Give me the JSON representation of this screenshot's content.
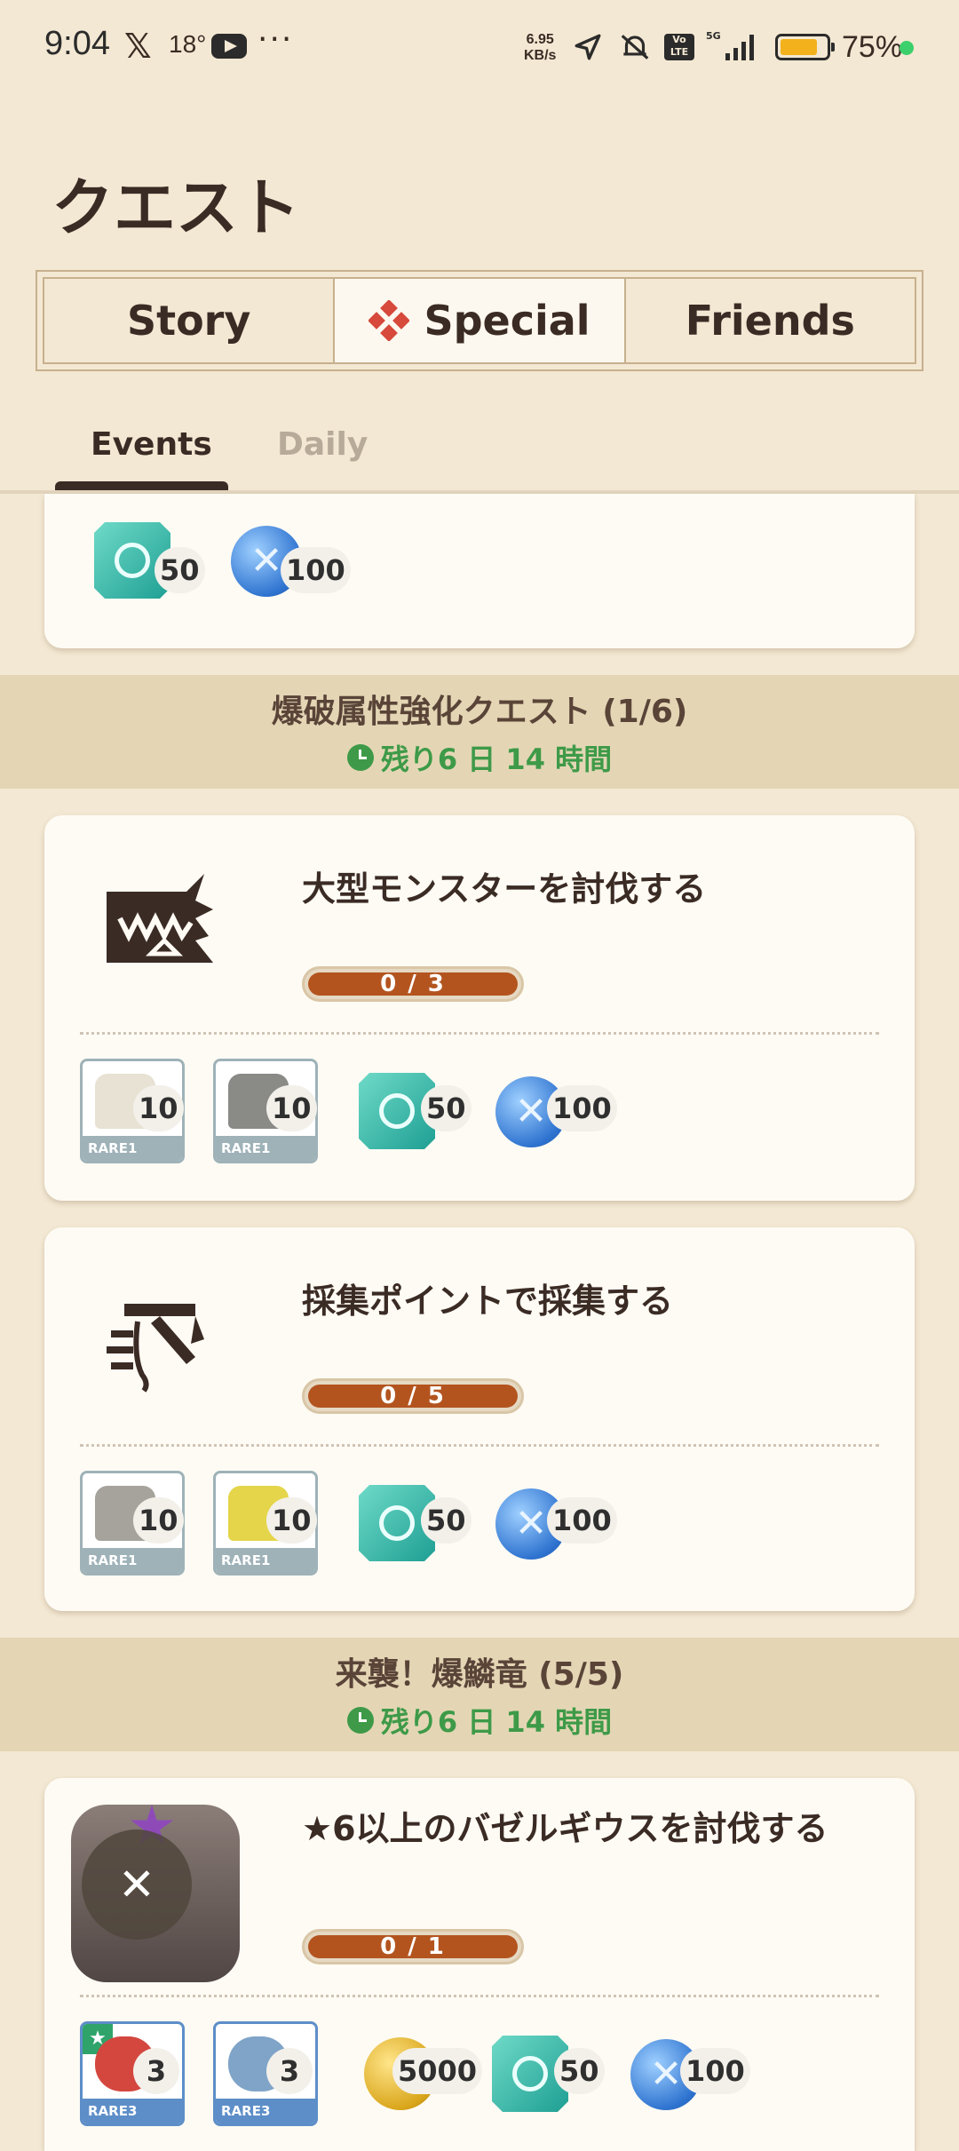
{
  "status": {
    "time": "9:04",
    "temperature": "18°",
    "speed_value": "6.95",
    "speed_unit": "KB/s",
    "network": "5G",
    "volte": "Vo LTE",
    "battery": "75%",
    "battery_level": 0.75
  },
  "page_title": "クエスト",
  "main_tabs": [
    {
      "label": "Story",
      "active": false
    },
    {
      "label": "Special",
      "active": true
    },
    {
      "label": "Friends",
      "active": false
    }
  ],
  "sub_tabs": [
    {
      "label": "Events",
      "active": true
    },
    {
      "label": "Daily",
      "active": false
    }
  ],
  "top_card": {
    "rewards": [
      {
        "icon": "gem-icon",
        "count": "50"
      },
      {
        "icon": "orb-icon",
        "count": "100"
      }
    ]
  },
  "sections": [
    {
      "title": "爆破属性強化クエスト (1/6)",
      "remaining": "残り6 日 14 時間",
      "quests": [
        {
          "title": "大型モンスターを討伐する",
          "progress": "0 / 3",
          "rewards": [
            {
              "type": "item",
              "rarity": "RARE1",
              "count": "10"
            },
            {
              "type": "item",
              "rarity": "RARE1",
              "count": "10"
            },
            {
              "type": "gem",
              "count": "50"
            },
            {
              "type": "orb",
              "count": "100"
            }
          ]
        },
        {
          "title": "採集ポイントで採集する",
          "progress": "0 / 5",
          "rewards": [
            {
              "type": "item",
              "rarity": "RARE1",
              "count": "10"
            },
            {
              "type": "item",
              "rarity": "RARE1",
              "count": "10"
            },
            {
              "type": "gem",
              "count": "50"
            },
            {
              "type": "orb",
              "count": "100"
            }
          ]
        }
      ]
    },
    {
      "title": "来襲！爆鱗竜 (5/5)",
      "remaining": "残り6 日 14 時間",
      "quests": [
        {
          "title": "★6以上のバゼルギウスを討伐する",
          "progress": "0 / 1",
          "rewards": [
            {
              "type": "item",
              "rarity": "RARE3",
              "count": "3"
            },
            {
              "type": "item",
              "rarity": "RARE3",
              "count": "3"
            },
            {
              "type": "coin",
              "count": "5000"
            },
            {
              "type": "gem",
              "count": "50"
            },
            {
              "type": "orb",
              "count": "100"
            }
          ]
        }
      ]
    }
  ],
  "colors": {
    "background": "#f3e8d3",
    "progress": "#b3541f",
    "remaining": "#3e9a48",
    "section_band": "#e4d6b5"
  }
}
